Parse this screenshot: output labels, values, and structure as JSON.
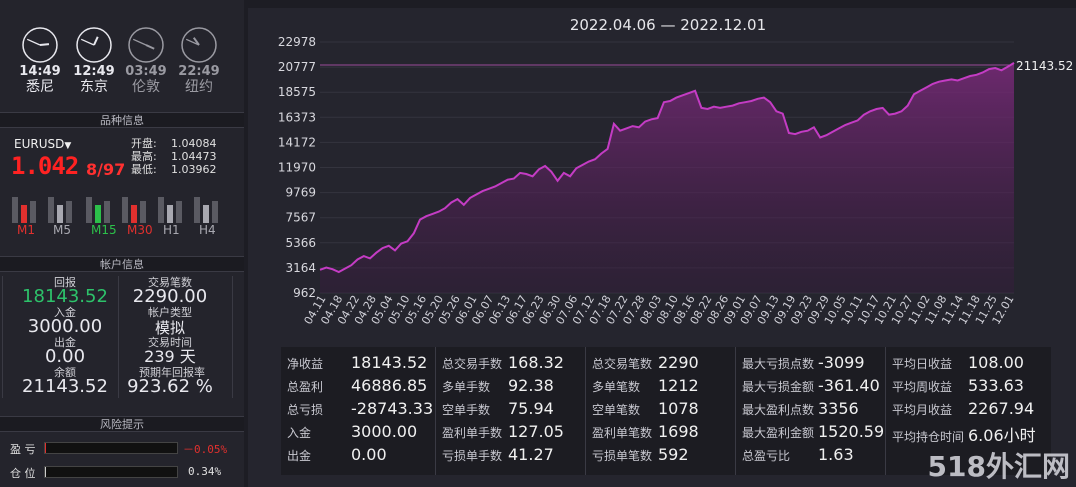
{
  "clocks": [
    {
      "time": "14:49",
      "city": "悉尼",
      "active": true,
      "h": 14,
      "m": 49
    },
    {
      "time": "12:49",
      "city": "东京",
      "active": true,
      "h": 12,
      "m": 49
    },
    {
      "time": "03:49",
      "city": "伦敦",
      "active": false,
      "h": 3,
      "m": 49
    },
    {
      "time": "22:49",
      "city": "纽约",
      "active": false,
      "h": 22,
      "m": 49
    }
  ],
  "sections": {
    "product_info": "品种信息",
    "account_info": "帐户信息",
    "risk": "风险提示"
  },
  "symbol": {
    "name": "EURUSD",
    "price_main": "1.042",
    "price_tail": "8/97",
    "open_label": "开盘:",
    "open": "1.04084",
    "high_label": "最高:",
    "high": "1.04473",
    "low_label": "最低:",
    "low": "1.03962"
  },
  "timeframes": [
    {
      "label": "M1",
      "color": "#e0302e"
    },
    {
      "label": "M5",
      "color": "#a8a8b0"
    },
    {
      "label": "M15",
      "color": "#2cc04a"
    },
    {
      "label": "M30",
      "color": "#e0302e"
    },
    {
      "label": "H1",
      "color": "#a8a8b0"
    },
    {
      "label": "H4",
      "color": "#a8a8b0"
    }
  ],
  "account": {
    "return_label": "回报",
    "return_value": "18143.52",
    "trades_label": "交易笔数",
    "trades_value": "2290.00",
    "deposit_label": "入金",
    "deposit_value": "3000.00",
    "acct_type_label": "帐户类型",
    "acct_type_value": "模拟",
    "withdraw_label": "出金",
    "withdraw_value": "0.00",
    "trade_time_label": "交易时间",
    "trade_time_value": "239 天",
    "balance_label": "余额",
    "balance_value": "21143.52",
    "annual_label": "预期年回报率",
    "annual_value": "923.62 %"
  },
  "risk": {
    "pnl_label": "盈 亏",
    "pnl_value": "－0.05%",
    "pos_label": "仓 位",
    "pos_value": "0.34%"
  },
  "chart_title": "2022.04.06 — 2022.12.01",
  "chart_data": {
    "type": "area",
    "yticks": [
      962,
      3164,
      5366,
      7567,
      9769,
      11970,
      14172,
      16373,
      18575,
      20777,
      22978
    ],
    "ylim": [
      962,
      22978
    ],
    "last_value_label": "21143.52",
    "xticks": [
      "04.11",
      "04.18",
      "04.22",
      "04.28",
      "05.04",
      "05.10",
      "05.16",
      "05.20",
      "05.26",
      "06.01",
      "06.07",
      "06.13",
      "06.17",
      "06.23",
      "06.30",
      "07.06",
      "07.12",
      "07.18",
      "07.22",
      "07.28",
      "08.03",
      "08.10",
      "08.16",
      "08.22",
      "08.26",
      "09.01",
      "09.07",
      "09.13",
      "09.19",
      "09.23",
      "09.29",
      "10.05",
      "10.11",
      "10.17",
      "10.21",
      "10.27",
      "11.02",
      "11.08",
      "11.14",
      "11.18",
      "11.25",
      "12.01"
    ],
    "values": [
      3000,
      3200,
      3050,
      2800,
      3100,
      3400,
      3900,
      4200,
      4000,
      4500,
      4900,
      5100,
      4700,
      5300,
      5500,
      6200,
      7400,
      7700,
      7900,
      8100,
      8400,
      8900,
      9200,
      8700,
      9300,
      9600,
      9900,
      10100,
      10300,
      10600,
      10900,
      11000,
      11500,
      11400,
      11200,
      11800,
      12100,
      11600,
      10800,
      11500,
      11200,
      11900,
      12200,
      12500,
      12700,
      13200,
      13600,
      15800,
      15200,
      15400,
      15600,
      15500,
      16000,
      16200,
      16300,
      17700,
      17800,
      18100,
      18300,
      18500,
      18700,
      17200,
      17100,
      17300,
      17200,
      17300,
      17400,
      17600,
      17700,
      17800,
      18000,
      18100,
      17700,
      16900,
      16700,
      15000,
      14900,
      15100,
      15200,
      15500,
      14600,
      14800,
      15100,
      15400,
      15700,
      15900,
      16100,
      16600,
      16900,
      17100,
      17200,
      16600,
      16700,
      16900,
      17400,
      18400,
      18700,
      19000,
      19300,
      19500,
      19600,
      19700,
      19600,
      19800,
      20000,
      20100,
      20300,
      20600,
      20700,
      20500,
      20800,
      21143
    ]
  },
  "stats": [
    [
      [
        "净收益",
        "18143.52"
      ],
      [
        "总盈利",
        "46886.85"
      ],
      [
        "总亏损",
        "-28743.33"
      ],
      [
        "入金",
        "3000.00"
      ],
      [
        "出金",
        "0.00"
      ]
    ],
    [
      [
        "总交易手数",
        "168.32"
      ],
      [
        "多单手数",
        "92.38"
      ],
      [
        "空单手数",
        "75.94"
      ],
      [
        "盈利单手数",
        "127.05"
      ],
      [
        "亏损单手数",
        "41.27"
      ]
    ],
    [
      [
        "总交易笔数",
        "2290"
      ],
      [
        "多单笔数",
        "1212"
      ],
      [
        "空单笔数",
        "1078"
      ],
      [
        "盈利单笔数",
        "1698"
      ],
      [
        "亏损单笔数",
        "592"
      ]
    ],
    [
      [
        "最大亏损点数",
        "-3099"
      ],
      [
        "最大亏损金额",
        "-361.40"
      ],
      [
        "最大盈利点数",
        "3356"
      ],
      [
        "最大盈利金额",
        "1520.59"
      ],
      [
        "总盈亏比",
        "1.63"
      ]
    ],
    [
      [
        "平均日收益",
        "108.00"
      ],
      [
        "平均周收益",
        "533.63"
      ],
      [
        "平均月收益",
        "2267.94"
      ],
      [
        "平均持仓时间",
        "6.06小时"
      ]
    ]
  ],
  "watermark": "518外汇网"
}
